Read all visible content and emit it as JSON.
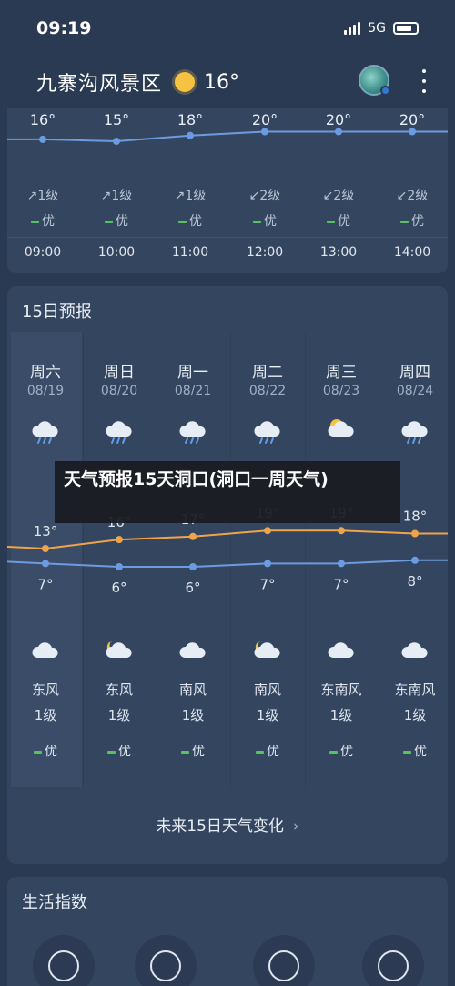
{
  "status_bar": {
    "time": "09:19",
    "network": "5G"
  },
  "header": {
    "location": "九寨沟风景区",
    "current_temp": "16°",
    "weather_icon": "sun-icon"
  },
  "hourly": {
    "items": [
      {
        "temp": "16°",
        "wind": "1级",
        "aq": "优",
        "time": "09:00"
      },
      {
        "temp": "15°",
        "wind": "1级",
        "aq": "优",
        "time": "10:00"
      },
      {
        "temp": "18°",
        "wind": "1级",
        "aq": "优",
        "time": "11:00"
      },
      {
        "temp": "20°",
        "wind": "2级",
        "aq": "优",
        "time": "12:00"
      },
      {
        "temp": "20°",
        "wind": "2级",
        "aq": "优",
        "time": "13:00"
      },
      {
        "temp": "20°",
        "wind": "2级",
        "aq": "优",
        "time": "14:00"
      }
    ]
  },
  "daily": {
    "title": "15日预报",
    "days": [
      {
        "name": "周六",
        "date": "08/19",
        "icon": "rain-cloud-icon",
        "high": "13°",
        "low": "7°",
        "night_icon": "cloud-icon",
        "wind": "东风",
        "level": "1级",
        "aq": "优"
      },
      {
        "name": "周日",
        "date": "08/20",
        "icon": "rain-cloud-icon",
        "high": "16°",
        "low": "6°",
        "night_icon": "moon-cloud-icon",
        "wind": "东风",
        "level": "1级",
        "aq": "优"
      },
      {
        "name": "周一",
        "date": "08/21",
        "icon": "rain-cloud-icon",
        "high": "17°",
        "low": "6°",
        "night_icon": "cloud-icon",
        "wind": "南风",
        "level": "1级",
        "aq": "优"
      },
      {
        "name": "周二",
        "date": "08/22",
        "icon": "rain-cloud-icon",
        "high": "19°",
        "low": "7°",
        "night_icon": "moon-cloud-icon",
        "wind": "南风",
        "level": "1级",
        "aq": "优"
      },
      {
        "name": "周三",
        "date": "08/23",
        "icon": "sun-cloud-icon",
        "high": "19°",
        "low": "7°",
        "night_icon": "cloud-icon",
        "wind": "东南风",
        "level": "1级",
        "aq": "优"
      },
      {
        "name": "周四",
        "date": "08/24",
        "icon": "rain-cloud-icon",
        "high": "18°",
        "low": "8°",
        "night_icon": "cloud-icon",
        "wind": "东南风",
        "level": "1级",
        "aq": "优"
      }
    ],
    "future_link": "未来15日天气变化"
  },
  "life": {
    "title": "生活指数",
    "icons": [
      "clothing-icon",
      "car-wash-icon",
      "sport-icon",
      "uv-icon"
    ]
  },
  "overlay": {
    "text": "天气预报15天洞口(洞口一周天气)"
  },
  "chart_data": {
    "type": "line",
    "title": "",
    "categories": [
      "08/19",
      "08/20",
      "08/21",
      "08/22",
      "08/23",
      "08/24"
    ],
    "series": [
      {
        "name": "",
        "values": [
          13,
          16,
          17,
          19,
          19,
          18
        ]
      },
      {
        "name": "",
        "values": [
          7,
          6,
          6,
          7,
          7,
          8
        ]
      }
    ],
    "hourly_series": {
      "categories": [
        "09:00",
        "10:00",
        "11:00",
        "12:00",
        "13:00",
        "14:00"
      ],
      "values": [
        16,
        15,
        18,
        20,
        20,
        20
      ]
    },
    "colors": {
      "high": "#f0a449",
      "low": "#6b9be0",
      "aq_good": "#57c35d"
    }
  }
}
